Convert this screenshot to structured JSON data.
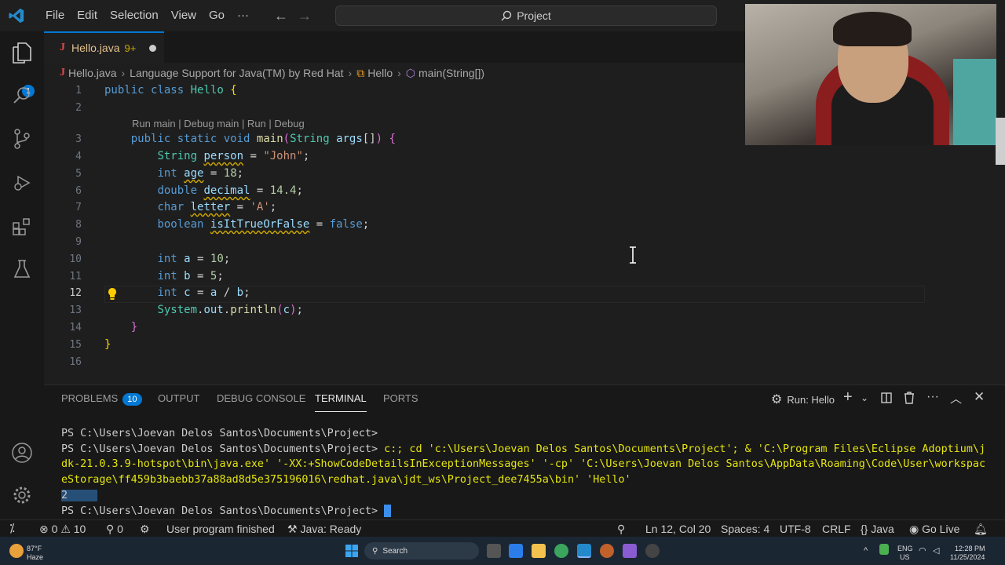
{
  "titlebar": {
    "menus": [
      "File",
      "Edit",
      "Selection",
      "View",
      "Go"
    ],
    "more": "···",
    "search": "Project"
  },
  "activity": {
    "explorer_badge": "1"
  },
  "tab": {
    "name": "Hello.java",
    "issues": "9+"
  },
  "breadcrumb": [
    "Hello.java",
    "Language Support for Java(TM) by Red Hat",
    "Hello",
    "main(String[])"
  ],
  "codelens": "Run main | Debug main | Run | Debug",
  "code": {
    "line_numbers": [
      "1",
      "2",
      "3",
      "4",
      "5",
      "6",
      "7",
      "8",
      "9",
      "10",
      "11",
      "12",
      "13",
      "14",
      "15",
      "16"
    ],
    "current_line": "12"
  },
  "panel": {
    "tabs": [
      "PROBLEMS",
      "OUTPUT",
      "DEBUG CONSOLE",
      "TERMINAL",
      "PORTS"
    ],
    "problems_count": "10",
    "run_label": "Run: Hello",
    "terminal": {
      "prompt1": "PS C:\\Users\\Joevan Delos Santos\\Documents\\Project> ",
      "prompt2": "PS C:\\Users\\Joevan Delos Santos\\Documents\\Project> ",
      "command": "c:; cd 'c:\\Users\\Joevan Delos Santos\\Documents\\Project'; & 'C:\\Program Files\\Eclipse Adoptium\\jdk-21.0.3.9-hotspot\\bin\\java.exe' '-XX:+ShowCodeDetailsInExceptionMessages' '-cp' 'C:\\Users\\Joevan Delos Santos\\AppData\\Roaming\\Code\\User\\workspaceStorage\\ff459b3baebb37a88ad8d5e375196016\\redhat.java\\jdt_ws\\Project_dee7455a\\bin' 'Hello'",
      "output": "2",
      "prompt3": "PS C:\\Users\\Joevan Delos Santos\\Documents\\Project> "
    }
  },
  "status": {
    "errors": "0",
    "warnings": "10",
    "ports": "0",
    "program": "User program finished",
    "java": "Java: Ready",
    "position": "Ln 12, Col 20",
    "spaces": "Spaces: 4",
    "encoding": "UTF-8",
    "eol": "CRLF",
    "language": "Java",
    "golive": "Go Live"
  },
  "taskbar": {
    "weather_temp": "87°F",
    "weather_desc": "Haze",
    "search": "Search",
    "lang1": "ENG",
    "lang2": "US",
    "time": "12:28 PM",
    "date": "11/25/2024"
  },
  "colors": {
    "accent": "#0078d4",
    "editor_bg": "#1f1f1f",
    "keyword": "#569cd6"
  }
}
